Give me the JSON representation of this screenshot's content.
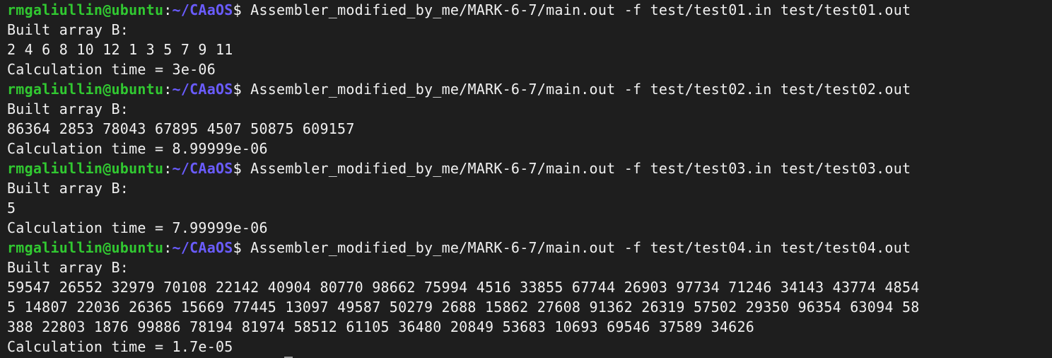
{
  "prompt": {
    "user_host": "rmgaliullin@ubuntu",
    "colon": ":",
    "path": "~/CAaOS",
    "dollar": "$"
  },
  "runs": [
    {
      "command": " Assembler_modified_by_me/MARK-6-7/main.out -f test/test01.in test/test01.out",
      "output": [
        "Built array B:",
        "2 4 6 8 10 12 1 3 5 7 9 11",
        "Calculation time = 3e-06"
      ]
    },
    {
      "command": " Assembler_modified_by_me/MARK-6-7/main.out -f test/test02.in test/test02.out",
      "output": [
        "Built array B:",
        "86364 2853 78043 67895 4507 50875 609157",
        "Calculation time = 8.99999e-06"
      ]
    },
    {
      "command": " Assembler_modified_by_me/MARK-6-7/main.out -f test/test03.in test/test03.out",
      "output": [
        "Built array B:",
        "5",
        "Calculation time = 7.99999e-06"
      ]
    },
    {
      "command": " Assembler_modified_by_me/MARK-6-7/main.out -f test/test04.in test/test04.out",
      "output": [
        "Built array B:",
        "59547 26552 32979 70108 22142 40904 80770 98662 75994 4516 33855 67744 26903 97734 71246 34143 43774 4854",
        "5 14807 22036 26365 15669 77445 13097 49587 50279 2688 15862 27608 91362 26319 57502 29350 96354 63094 58",
        "388 22803 1876 99886 78194 81974 58512 61105 36480 20849 53683 10693 69546 37589 34626",
        "Calculation time = 1.7e-05"
      ]
    }
  ]
}
